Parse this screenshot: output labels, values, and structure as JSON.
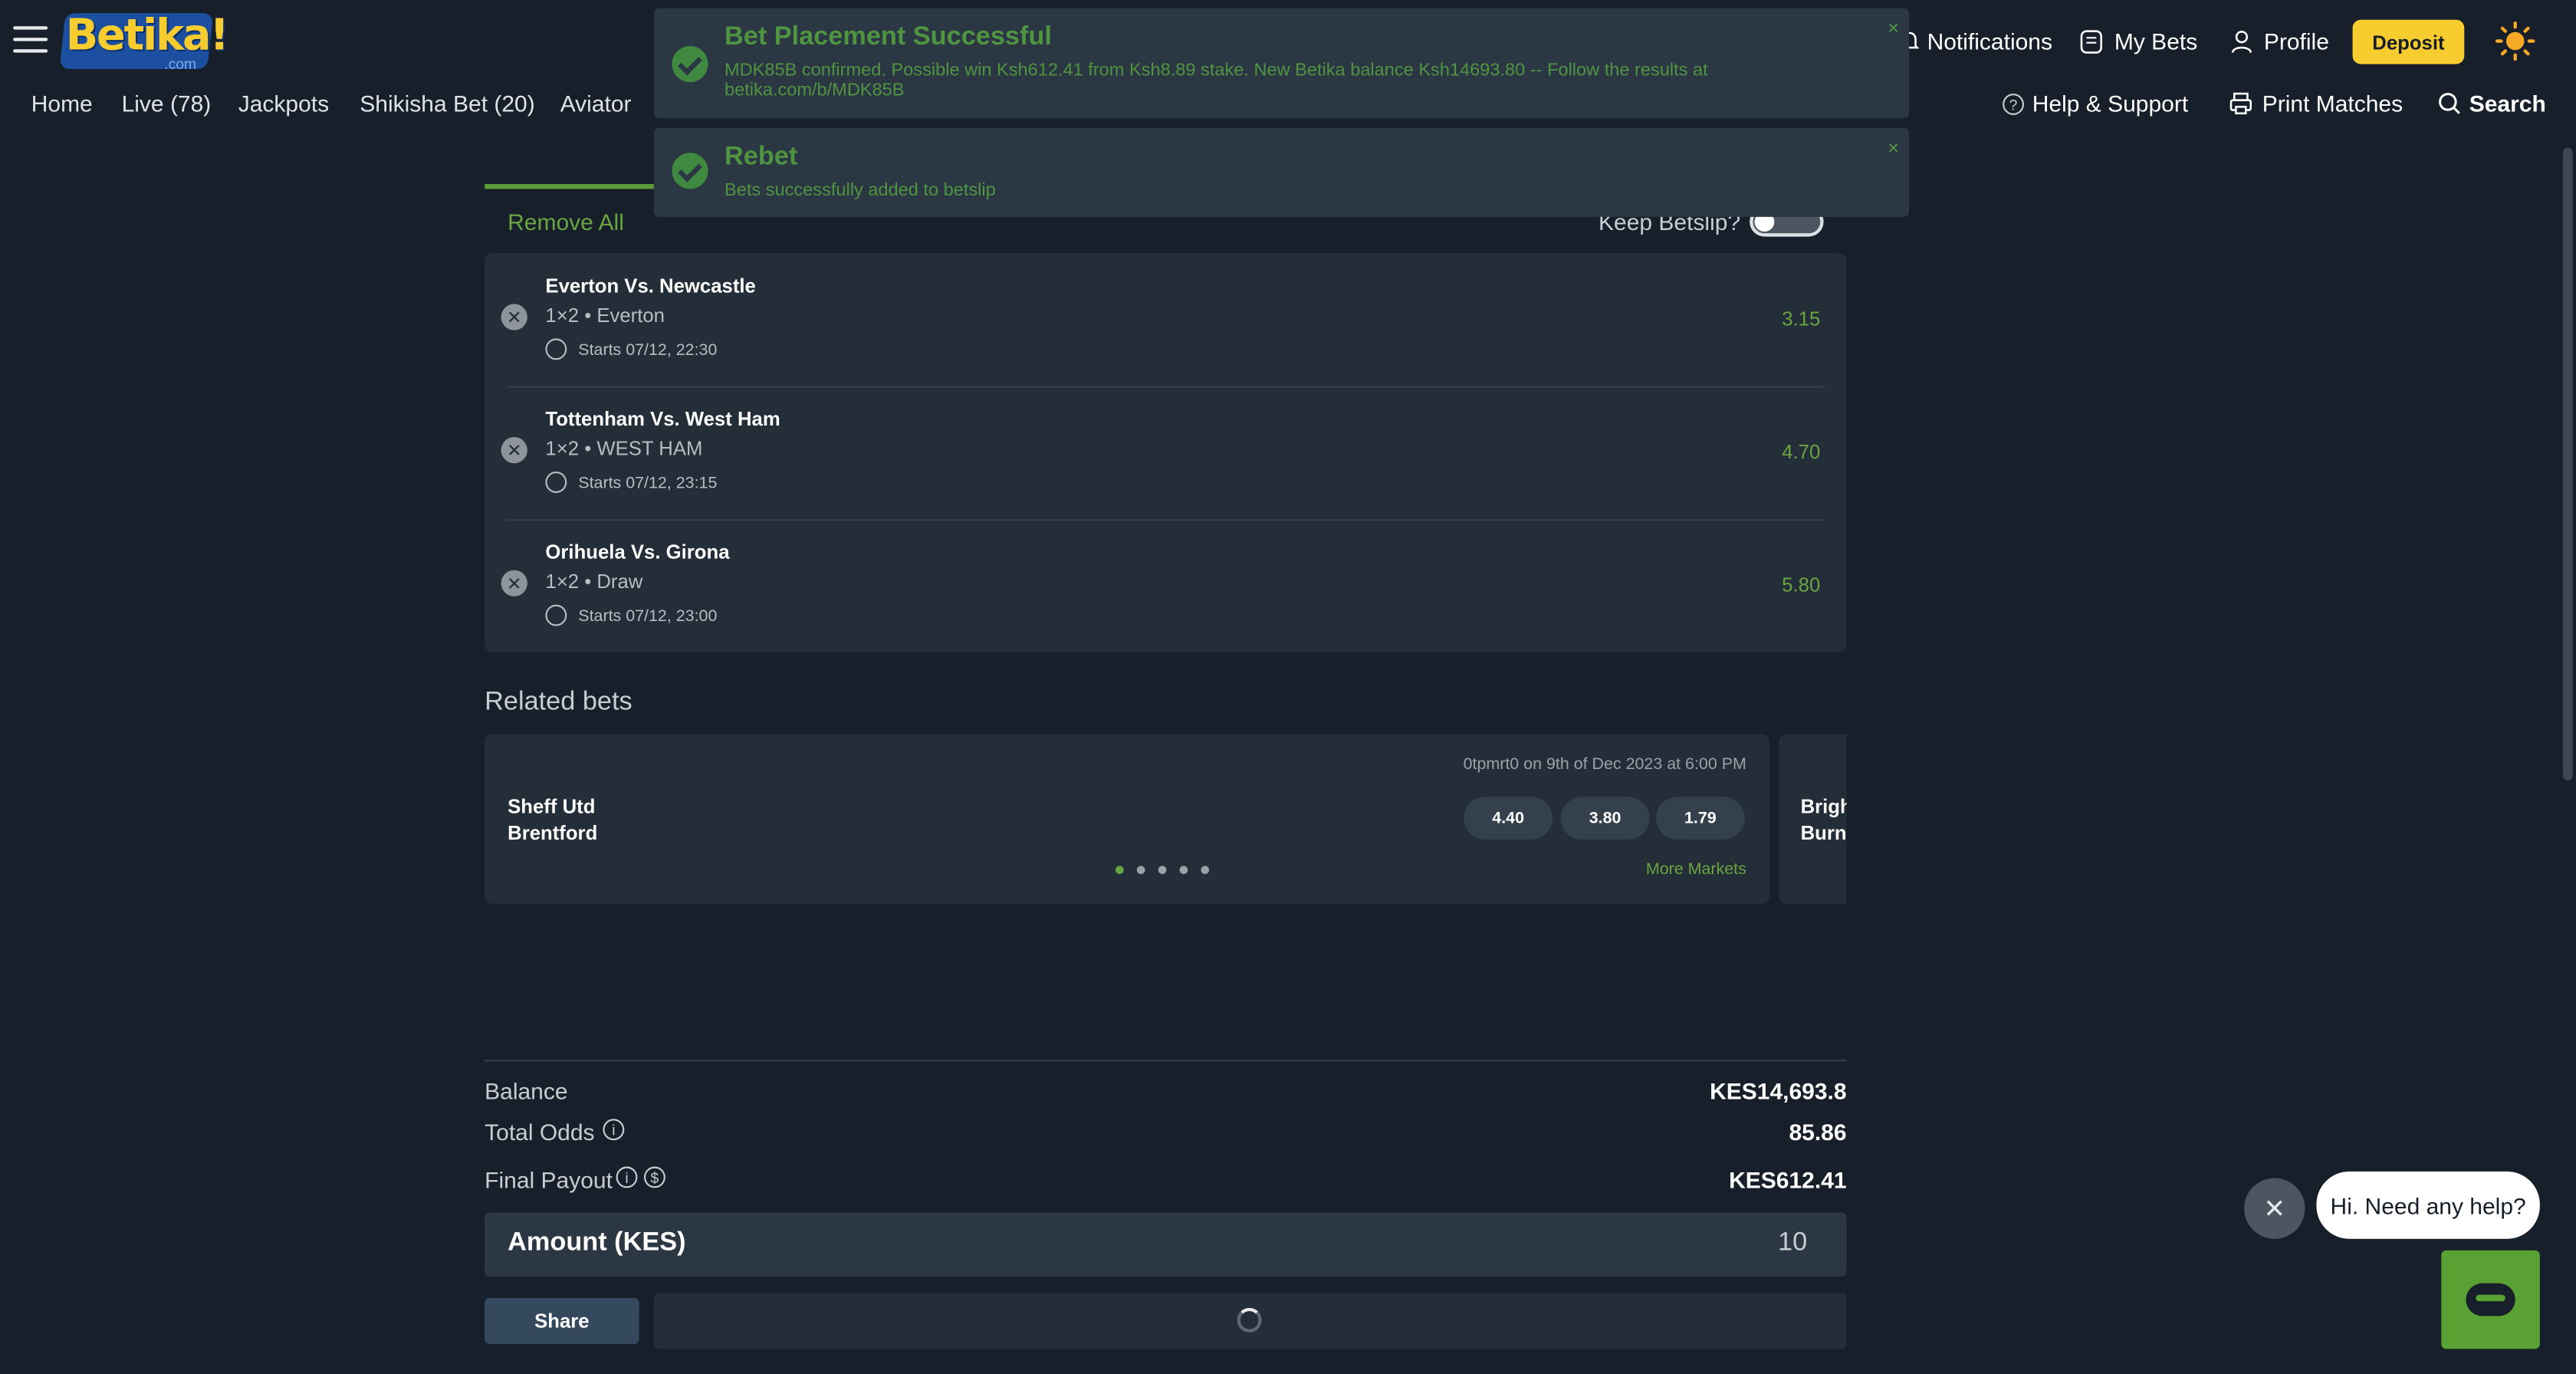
{
  "header": {
    "logo_text": "Betika!",
    "logo_suffix": ".com",
    "nav": [
      "Home",
      "Live (78)",
      "Jackpots",
      "Shikisha Bet (20)",
      "Aviator"
    ],
    "top_links": {
      "notifications": "Notifications",
      "my_bets": "My Bets",
      "profile": "Profile",
      "deposit": "Deposit"
    },
    "right_nav": {
      "help": "Help & Support",
      "print": "Print Matches",
      "search": "Search"
    }
  },
  "toasts": [
    {
      "title": "Bet Placement Successful",
      "body": "MDK85B confirmed. Possible win Ksh612.41 from Ksh8.89 stake. New Betika balance Ksh14693.80 -- Follow the results at betika.com/b/MDK85B",
      "close": "×"
    },
    {
      "title": "Rebet",
      "body": "Bets successfully added to betslip",
      "close": "×"
    }
  ],
  "betslip": {
    "remove_all": "Remove All",
    "keep_betslip": "Keep Betslip?",
    "bets": [
      {
        "match": "Everton Vs. Newcastle",
        "market": "1×2 •  Everton",
        "starts": "Starts 07/12, 22:30",
        "odd": "3.15"
      },
      {
        "match": "Tottenham Vs. West Ham",
        "market": "1×2 •  WEST HAM",
        "starts": "Starts 07/12, 23:15",
        "odd": "4.70"
      },
      {
        "match": "Orihuela Vs. Girona",
        "market": "1×2 •  Draw",
        "starts": "Starts 07/12, 23:00",
        "odd": "5.80"
      }
    ]
  },
  "related": {
    "title": "Related bets",
    "card": {
      "date": "0tpmrt0 on 9th of Dec 2023 at 6:00 PM",
      "home": "Sheff Utd",
      "away": "Brentford",
      "odds": [
        "4.40",
        "3.80",
        "1.79"
      ],
      "more": "More Markets"
    },
    "card2": {
      "home": "Brigh",
      "away": "Burnl"
    }
  },
  "summary": {
    "balance_label": "Balance",
    "balance": "KES14,693.8",
    "total_odds_label": "Total Odds",
    "total_odds": "85.86",
    "payout_label": "Final Payout",
    "payout": "KES612.41",
    "amount_label": "Amount (KES)",
    "amount": "10"
  },
  "actions": {
    "share": "Share"
  },
  "chat": {
    "message": "Hi. Need any help?",
    "close": "✕"
  },
  "colors": {
    "background": "#17202a",
    "accent_green": "#6aa541",
    "deposit_yellow": "#f7cc2e"
  }
}
